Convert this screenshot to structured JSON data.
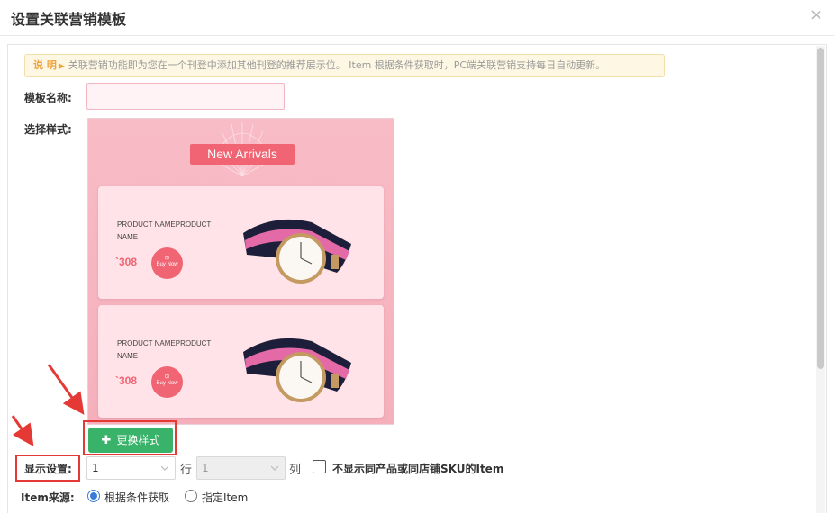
{
  "dialog": {
    "title": "设置关联营销模板",
    "close_glyph": "×"
  },
  "notice": {
    "label": "说 明",
    "arrow": "▶",
    "text": "关联营销功能即为您在一个刊登中添加其他刊登的推荐展示位。 Item 根据条件获取时，PC端关联营销支持每日自动更新。"
  },
  "form": {
    "template_name_label": "模板名称:",
    "template_name_value": "",
    "select_style_label": "选择样式:",
    "change_style_button": "更换样式",
    "display_settings_label": "显示设置:",
    "rows_value": "1",
    "rows_unit": "行",
    "cols_value": "1",
    "cols_unit": "列",
    "hide_same_sku_label": "不显示同产品或同店铺SKU的Item",
    "hide_same_sku_checked": false,
    "item_source_label": "Item来源:",
    "item_source_options": [
      "根据条件获取",
      "指定Item"
    ],
    "item_source_selected": "根据条件获取"
  },
  "preview": {
    "banner": "New Arrivals",
    "products": [
      {
        "name": "PRODUCT NAMEPRODUCT NAME",
        "price": "`308",
        "buy_label": "Buy Now"
      },
      {
        "name": "PRODUCT NAMEPRODUCT NAME",
        "price": "`308",
        "buy_label": "Buy Now"
      }
    ]
  },
  "colors": {
    "primary_green": "#39b36a",
    "highlight_red": "#e53935",
    "preview_pink": "#f8bcc6",
    "accent_pink": "#f06473",
    "notice_orange": "#f0a33a"
  },
  "icons": {
    "close": "close-icon",
    "plus": "plus-icon",
    "dropdown": "chevron-down-icon",
    "annotation": "red-arrow-icon"
  }
}
